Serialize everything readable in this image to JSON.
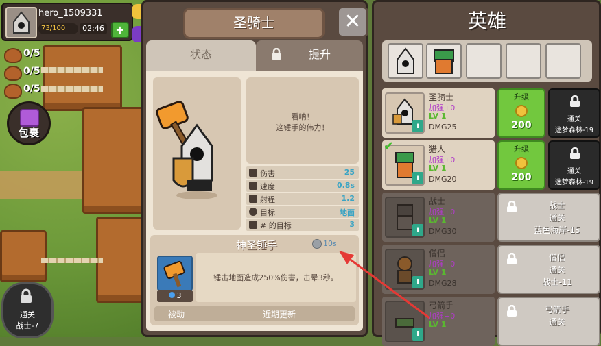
{
  "player": {
    "name": "hero_1509331",
    "energy": "73/100",
    "timer": "02:46",
    "plus": "+"
  },
  "resources": [
    {
      "value": "0/5"
    },
    {
      "value": "0/5"
    },
    {
      "value": "0/5"
    }
  ],
  "bag_label": "包裹",
  "locked_stage": {
    "line1": "通关",
    "line2": "战士-7"
  },
  "dialog": {
    "title": "圣骑士",
    "close": "✕",
    "tabs": {
      "status": "状态",
      "upgrade": "提升"
    },
    "speech_line1": "看呐！",
    "speech_line2": "这锤手的伟力！",
    "stats": [
      {
        "icon": "swords-icon",
        "label": "伤害",
        "value": "25"
      },
      {
        "icon": "speed-icon",
        "label": "速度",
        "value": "0.8s"
      },
      {
        "icon": "range-icon",
        "label": "射程",
        "value": "1.2"
      },
      {
        "icon": "target-icon",
        "label": "目标",
        "value": "地面"
      },
      {
        "icon": "person-icon",
        "label": "# 的目标",
        "value": "3"
      }
    ],
    "skill": {
      "name": "神圣锤手",
      "cooldown": "10s",
      "level": "3",
      "description": "锤击地面造成250%伤害，击晕3秒。",
      "type": "被动",
      "status": "近期更新"
    }
  },
  "heroes": {
    "title": "英雄",
    "roster": [
      {
        "name": "圣骑士",
        "plus": "加强+0",
        "lv": "LV 1",
        "dmg": "DMG25",
        "selected": false,
        "locked": false,
        "upgrade_label": "升级",
        "upgrade_cost": "200",
        "gate_line1": "通关",
        "gate_line2": "迷梦森林-19"
      },
      {
        "name": "猎人",
        "plus": "加强+0",
        "lv": "LV 1",
        "dmg": "DMG20",
        "selected": true,
        "locked": false,
        "upgrade_label": "升级",
        "upgrade_cost": "200",
        "gate_line1": "通关",
        "gate_line2": "迷梦森林-19"
      },
      {
        "name": "战士",
        "plus": "加强+0",
        "lv": "LV 1",
        "dmg": "DMG30",
        "selected": false,
        "locked": true,
        "unlock_line1": "战士",
        "unlock_line2": "通关",
        "unlock_line3": "蓝色海岸-15"
      },
      {
        "name": "僧侣",
        "plus": "加强+0",
        "lv": "LV 1",
        "dmg": "DMG28",
        "selected": false,
        "locked": true,
        "unlock_line1": "僧侣",
        "unlock_line2": "通关",
        "unlock_line3": "战士-11"
      },
      {
        "name": "弓箭手",
        "plus": "加强+0",
        "lv": "LV 1",
        "dmg": "",
        "selected": false,
        "locked": true,
        "unlock_line1": "弓箭手",
        "unlock_line2": "通关",
        "unlock_line3": ""
      }
    ]
  },
  "colors": {
    "accent_green": "#72c83e",
    "stat_value_blue": "#3aa4c4",
    "enhance_purple": "#b03cc8",
    "arrow_red": "#e53935"
  }
}
